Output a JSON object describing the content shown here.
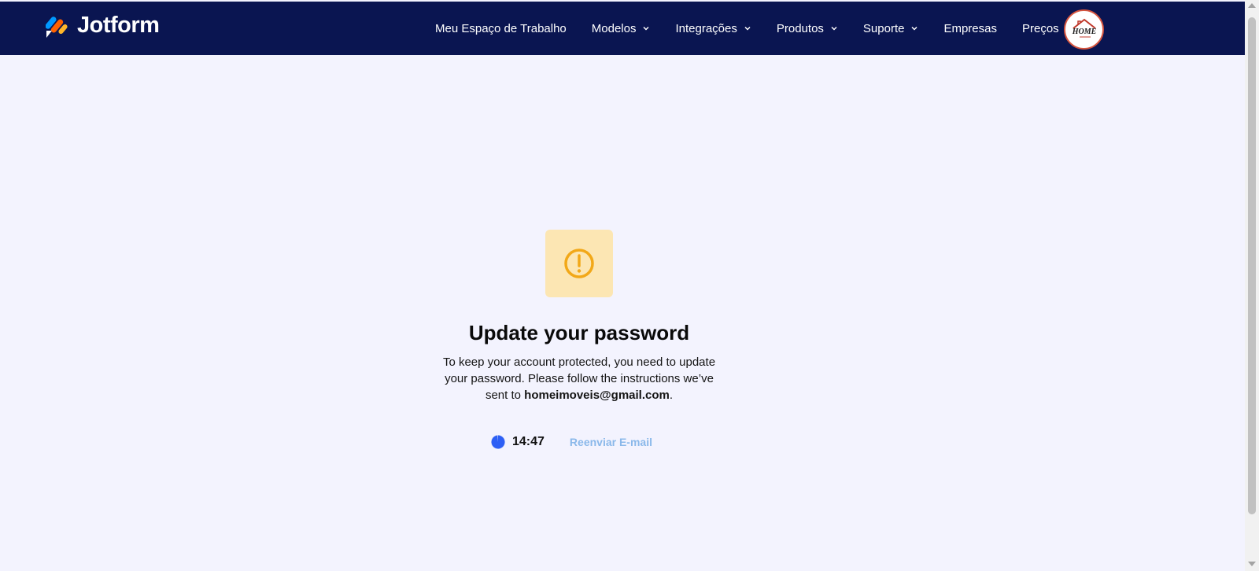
{
  "brand": {
    "name": "Jotform"
  },
  "nav": {
    "items": [
      {
        "label": "Meu Espaço de Trabalho",
        "has_dropdown": false
      },
      {
        "label": "Modelos",
        "has_dropdown": true
      },
      {
        "label": "Integrações",
        "has_dropdown": true
      },
      {
        "label": "Produtos",
        "has_dropdown": true
      },
      {
        "label": "Suporte",
        "has_dropdown": true
      },
      {
        "label": "Empresas",
        "has_dropdown": false
      },
      {
        "label": "Preços",
        "has_dropdown": false
      }
    ]
  },
  "avatar": {
    "logo_text": "HOME",
    "icon": "home-imoveis-logo-icon"
  },
  "main": {
    "icon": "warning-icon",
    "title": "Update your password",
    "message_prefix": "To keep your account protected, you need to update your password. Please follow the instructions we’ve sent to",
    "email": "homeimoveis@gmail.com",
    "message_suffix": ".",
    "timer": "14:47",
    "resend_label": "Reenviar E-mail"
  },
  "colors": {
    "header_bg": "#0a1551",
    "page_bg": "#f3f3fe",
    "warning_bg": "#fce6b3",
    "warning_icon": "#f2a818",
    "timer_blue": "#2d5ff5",
    "resend_link": "#8ab8ea"
  }
}
